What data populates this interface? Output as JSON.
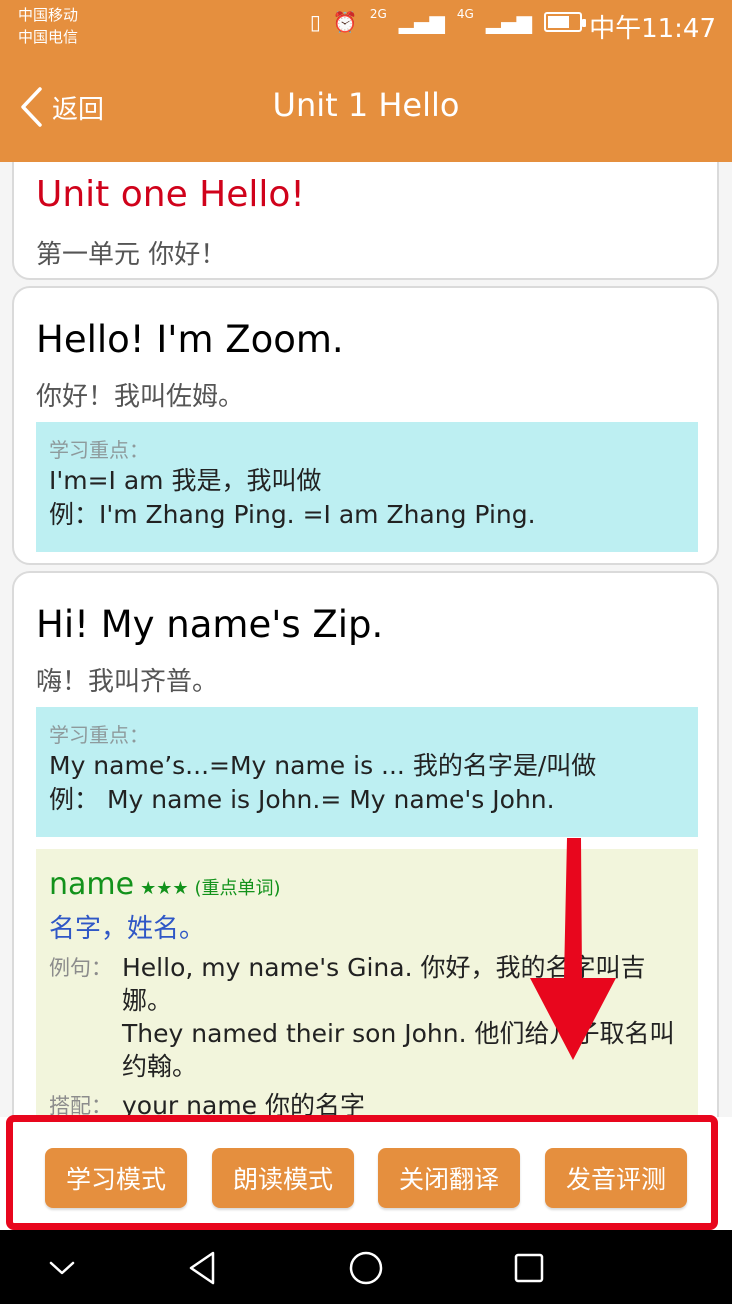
{
  "status_bar": {
    "carrier1": "中国移动",
    "carrier2": "中国电信",
    "signal_a": "2G",
    "signal_b": "4G",
    "battery_level": 0.7,
    "time": "中午11:47"
  },
  "header": {
    "back_label": "返回",
    "title": "Unit 1 Hello"
  },
  "unit": {
    "title_en": "Unit one Hello!",
    "title_cn": "第一单元 你好！"
  },
  "sentences": [
    {
      "en": "Hello! I'm Zoom.",
      "cn": "你好！我叫佐姆。",
      "key_title": "学习重点：",
      "key_lines": [
        "I'm=I am 我是，我叫做",
        "例：I'm Zhang Ping. =I am Zhang Ping."
      ]
    },
    {
      "en": "Hi! My name's Zip.",
      "cn": "嗨！我叫齐普。",
      "key_title": "学习重点：",
      "key_lines": [
        "My name’s...=My name is ... 我的名字是/叫做",
        "例： My name is John.= My name's John."
      ],
      "word": {
        "word": "name",
        "stars": "★★★",
        "tag": "(重点单词)",
        "meaning": "名字，姓名。",
        "example_label": "例句：",
        "examples": [
          "Hello, my name's Gina. 你好，我的名字叫吉娜。",
          "They named their son John. 他们给儿子取名叫约翰。"
        ],
        "collocation_label": "搭配：",
        "collocation": "your name 你的名字"
      }
    }
  ],
  "buttons": {
    "study_mode": "学习模式",
    "read_mode": "朗读模式",
    "close_translation": "关闭翻译",
    "pronunciation_test": "发音评测"
  },
  "colors": {
    "accent": "#e58f3e",
    "highlight": "#e8061d",
    "key_bg": "#bdeff2",
    "word_bg": "#f2f5dc"
  }
}
